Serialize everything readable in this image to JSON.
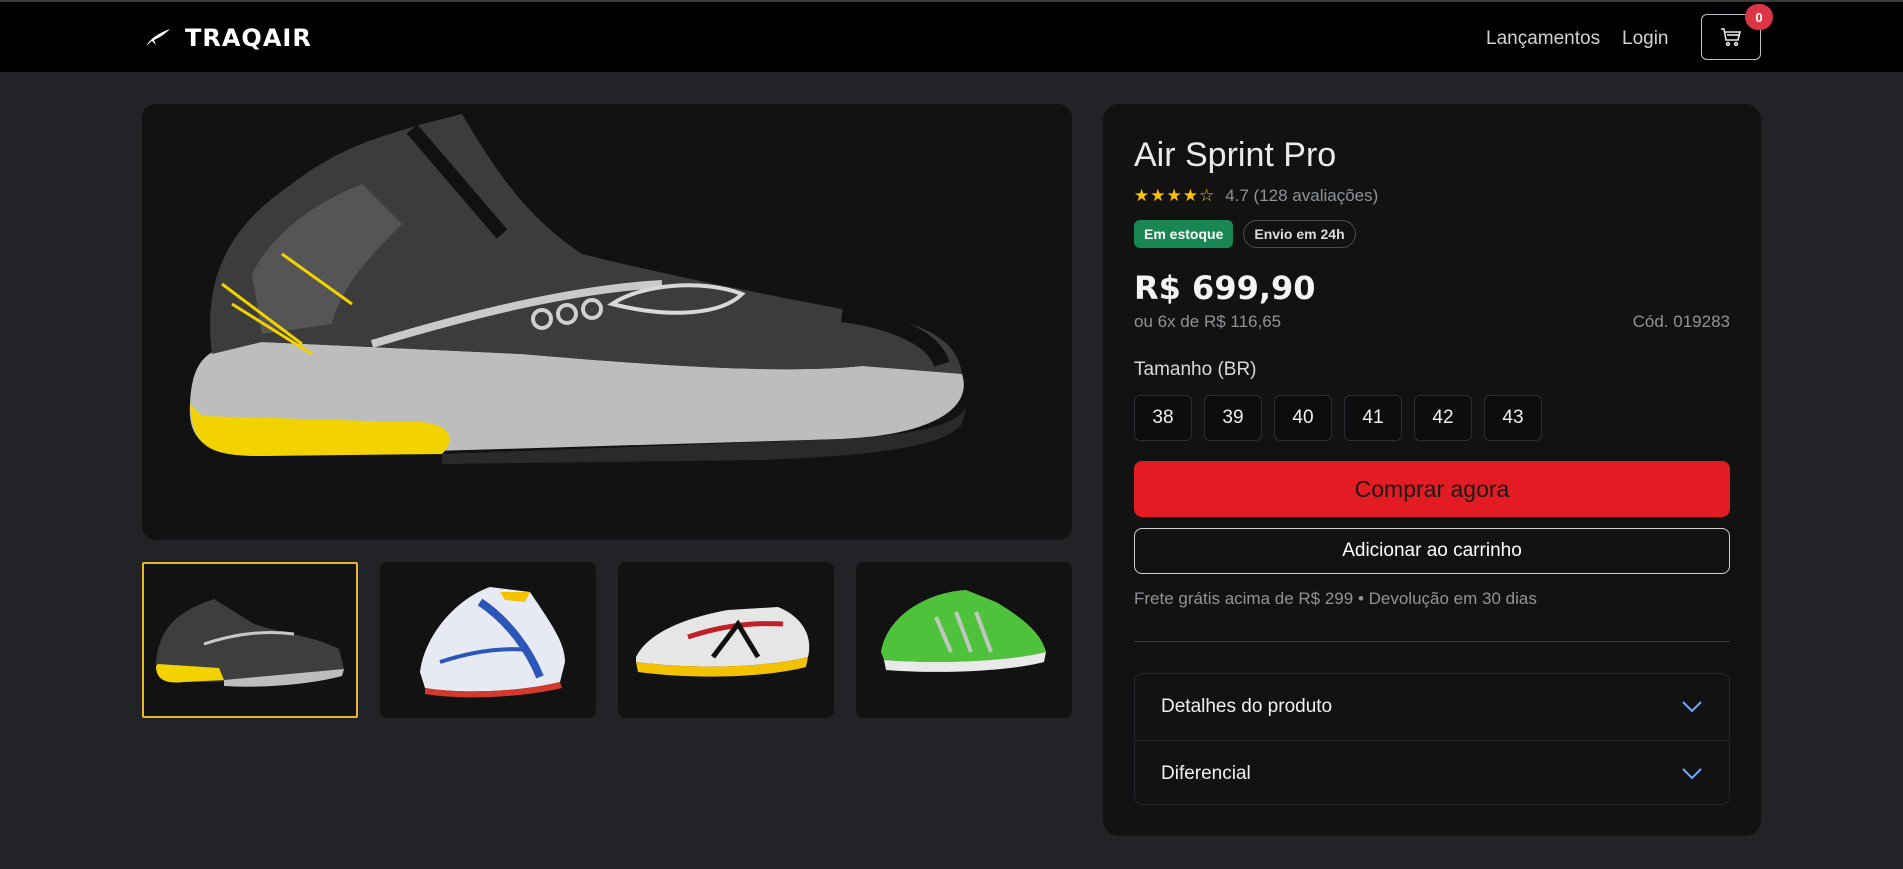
{
  "header": {
    "brand": "TRAQAIR",
    "nav": [
      {
        "label": "Lançamentos"
      },
      {
        "label": "Login"
      }
    ],
    "cart_count": "0"
  },
  "gallery": {
    "main_image": "black-yellow-running-shoe",
    "thumbnails": [
      {
        "name": "black-yellow-running-shoe",
        "active": true
      },
      {
        "name": "white-blue-red-running-shoe",
        "active": false
      },
      {
        "name": "white-red-yellow-running-shoe",
        "active": false
      },
      {
        "name": "green-running-shoe",
        "active": false
      }
    ]
  },
  "product": {
    "title": "Air Sprint Pro",
    "rating_stars": "★★★★☆",
    "rating_text": "4.7 (128 avaliações)",
    "badge_stock": "Em estoque",
    "badge_shipping": "Envio em 24h",
    "price": "R$ 699,90",
    "installments": "ou 6x de R$ 116,65",
    "sku": "Cód. 019283",
    "size_label": "Tamanho (BR)",
    "sizes": [
      "38",
      "39",
      "40",
      "41",
      "42",
      "43"
    ],
    "buy_label": "Comprar agora",
    "add_to_cart_label": "Adicionar ao carrinho",
    "shipping_note": "Frete grátis acima de R$ 299 • Devolução em 30 dias",
    "accordion": [
      {
        "label": "Detalhes do produto"
      },
      {
        "label": "Diferencial"
      }
    ]
  },
  "colors": {
    "accent_red": "#e31b23",
    "badge_green": "#198754",
    "star_yellow": "#ffc107",
    "chevron_blue": "#6ea8fe",
    "active_thumb_border": "#e7b52a"
  }
}
